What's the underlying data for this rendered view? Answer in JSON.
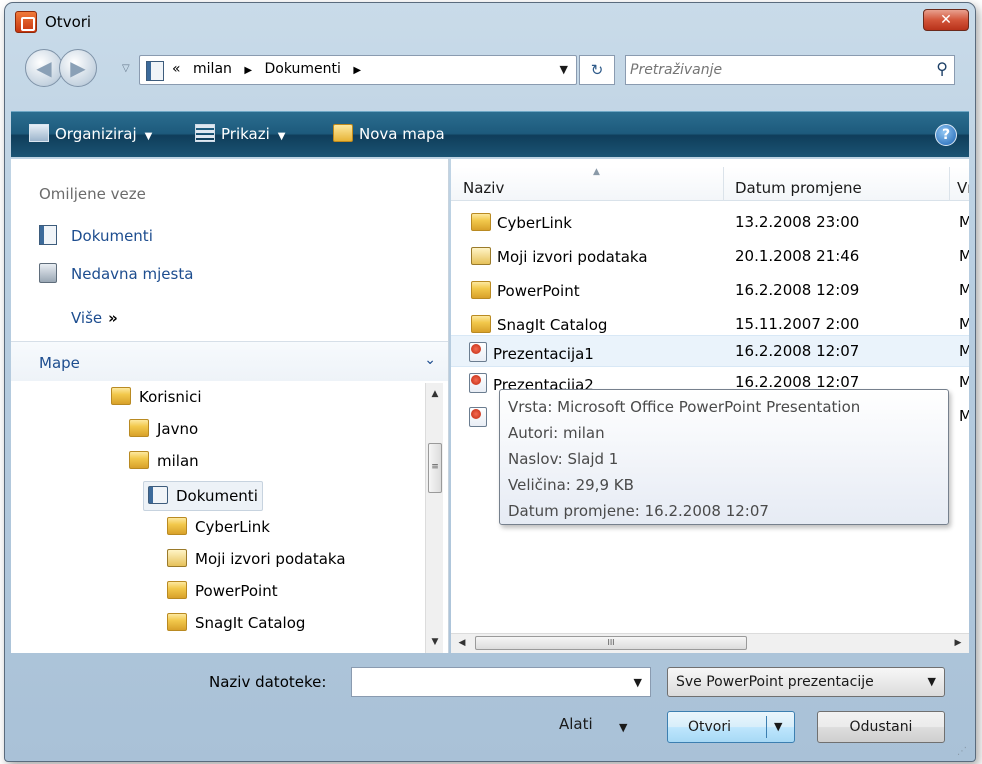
{
  "window": {
    "title": "Otvori",
    "close_label": "✕"
  },
  "nav": {
    "back_label": "◀",
    "forward_label": "▶",
    "history_label": "▽",
    "address": [
      "«",
      "milan",
      "▶",
      "Dokumenti",
      "▶"
    ],
    "address_dropdown": "▼",
    "refresh_label": "↻",
    "search_placeholder": "Pretraživanje",
    "search_icon": "⚲"
  },
  "toolbar": {
    "organize_label": "Organiziraj",
    "views_label": "Prikazi",
    "new_folder_label": "Nova mapa",
    "caret": "▼",
    "help_label": "?"
  },
  "favorites": {
    "title": "Omiljene veze",
    "items": [
      {
        "label": "Dokumenti",
        "icon": "documents-icon"
      },
      {
        "label": "Nedavna mjesta",
        "icon": "recent-places-icon"
      }
    ],
    "more_label": "Više",
    "more_glyph": "»"
  },
  "folders": {
    "title": "Mape",
    "chevron": "⌄",
    "tree": [
      {
        "label": "Korisnici",
        "icon": "folder-icon"
      },
      {
        "label": "Javno",
        "icon": "folder-icon"
      },
      {
        "label": "milan",
        "icon": "folder-icon"
      },
      {
        "label": "Dokumenti",
        "icon": "documents-icon",
        "selected": true
      },
      {
        "label": "CyberLink",
        "icon": "folder-icon"
      },
      {
        "label": "Moji izvori podataka",
        "icon": "data-sources-icon"
      },
      {
        "label": "PowerPoint",
        "icon": "folder-icon"
      },
      {
        "label": "SnagIt Catalog",
        "icon": "folder-icon"
      }
    ]
  },
  "scroll": {
    "up": "▲",
    "down": "▼",
    "left": "◀",
    "right": "▶",
    "grip": "≡",
    "hgrip": "III"
  },
  "files": {
    "columns": [
      "Naziv",
      "Datum promjene",
      "Vrs"
    ],
    "sort_arrow": "▲",
    "rows": [
      {
        "name": "CyberLink",
        "date": "13.2.2008 23:00",
        "type": "Ma",
        "icon": "folder-icon"
      },
      {
        "name": "Moji izvori podataka",
        "date": "20.1.2008 21:46",
        "type": "Ma",
        "icon": "data-sources-icon"
      },
      {
        "name": "PowerPoint",
        "date": "16.2.2008 12:09",
        "type": "Ma",
        "icon": "folder-icon"
      },
      {
        "name": "SnagIt Catalog",
        "date": "15.11.2007 2:00",
        "type": "Ma",
        "icon": "folder-icon"
      },
      {
        "name": "Prezentacija1",
        "date": "16.2.2008 12:07",
        "type": "Mi",
        "icon": "powerpoint-file-icon"
      },
      {
        "name": "Prezentacija2",
        "date": "16.2.2008 12:07",
        "type": "Mi",
        "icon": "powerpoint-file-icon"
      },
      {
        "name": "",
        "date": "",
        "type": "Mi",
        "icon": "powerpoint-file-icon"
      }
    ]
  },
  "tooltip": {
    "lines": [
      "Vrsta: Microsoft Office PowerPoint Presentation",
      "Autori: milan",
      "Naslov: Slajd 1",
      "Veličina: 29,9 KB",
      "Datum promjene: 16.2.2008 12:07"
    ]
  },
  "footer": {
    "filename_label": "Naziv datoteke:",
    "filename_value": "",
    "filename_dropdown": "▼",
    "filetype_value": "Sve PowerPoint prezentacije",
    "filetype_dropdown": "▼",
    "tools_label": "Alati",
    "tools_caret": "▼",
    "open_label": "Otvori",
    "open_dropdown": "▼",
    "cancel_label": "Odustani",
    "grip": "⋰"
  }
}
